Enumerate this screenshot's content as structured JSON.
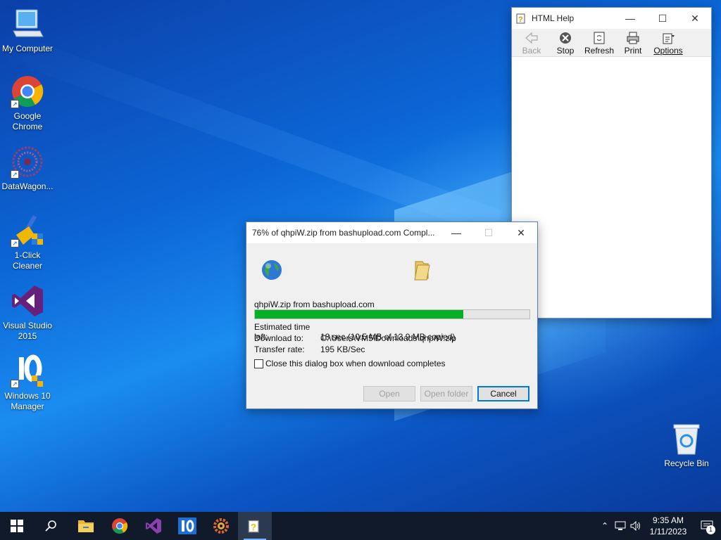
{
  "desktop": {
    "icons": [
      {
        "label": "My Computer"
      },
      {
        "label": "Google Chrome"
      },
      {
        "label": "DataWagon..."
      },
      {
        "label": "1-Click Cleaner"
      },
      {
        "label": "Visual Studio 2015"
      },
      {
        "label": "Windows 10 Manager"
      },
      {
        "label": "Recycle Bin"
      }
    ]
  },
  "help_window": {
    "title": "HTML Help",
    "toolbar": {
      "back": "Back",
      "stop": "Stop",
      "refresh": "Refresh",
      "print": "Print",
      "options": "Options"
    }
  },
  "download_dialog": {
    "title": "76% of qhpiW.zip from bashupload.com Compl...",
    "source": "qhpiW.zip from bashupload.com",
    "progress_percent": 76,
    "rows": [
      {
        "label": "Estimated time left:",
        "value": "18 sec (10.5 MB of 13.9 MB copied)"
      },
      {
        "label": "Download to:",
        "value": "C:\\Users\\VM5\\Downloads\\qhpiW.zip"
      },
      {
        "label": "Transfer rate:",
        "value": "195 KB/Sec"
      }
    ],
    "close_checkbox_label": "Close this dialog box when download completes",
    "buttons": {
      "open": "Open",
      "open_folder": "Open folder",
      "cancel": "Cancel"
    }
  },
  "taskbar": {
    "time": "9:35 AM",
    "date": "1/11/2023",
    "notification_count": "1"
  },
  "colors": {
    "progress": "#06b025",
    "accent": "#0078d7",
    "taskbar": "#101a2a"
  }
}
